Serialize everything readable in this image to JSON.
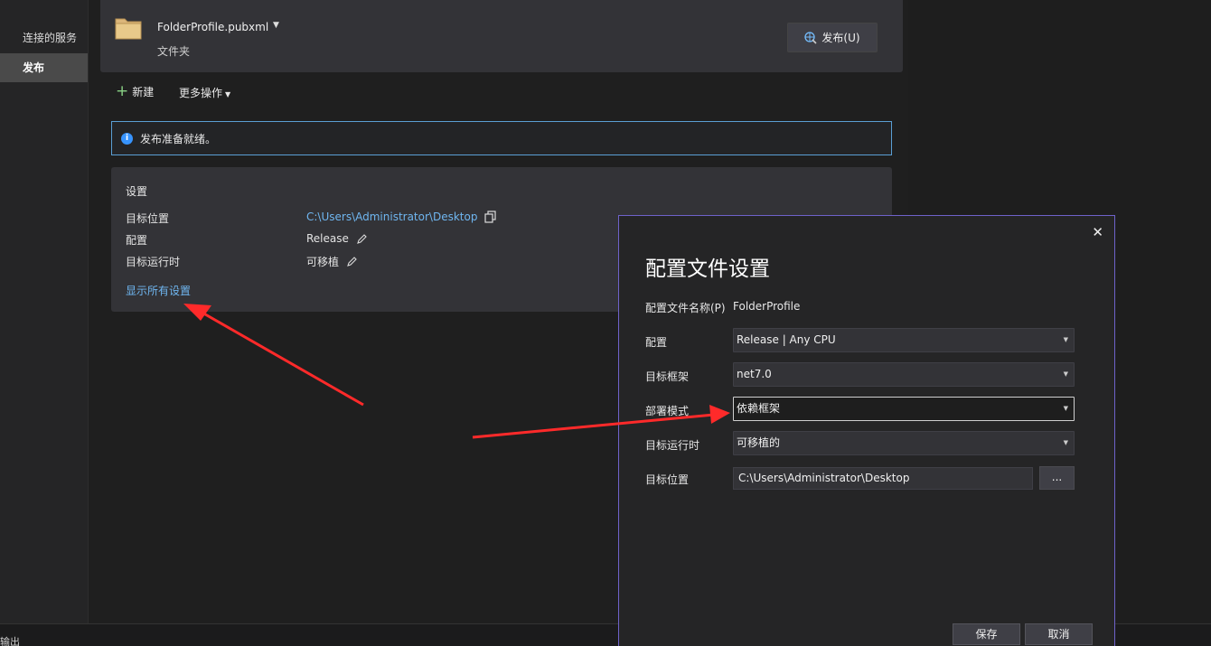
{
  "sidebar": {
    "items": [
      {
        "label": "连接的服务"
      },
      {
        "label": "发布"
      }
    ]
  },
  "profile": {
    "name": "FolderProfile.pubxml",
    "type": "文件夹",
    "publish_label": "发布(U)"
  },
  "toolbar": {
    "new_label": "新建",
    "more_label": "更多操作"
  },
  "info": {
    "message": "发布准备就绪。"
  },
  "settings": {
    "title": "设置",
    "rows": [
      {
        "label": "目标位置",
        "value": "C:\\Users\\Administrator\\Desktop"
      },
      {
        "label": "配置",
        "value": "Release"
      },
      {
        "label": "目标运行时",
        "value": "可移植"
      }
    ],
    "show_all": "显示所有设置"
  },
  "dialog": {
    "title": "配置文件设置",
    "profile_name_label": "配置文件名称(P)",
    "profile_name_value": "FolderProfile",
    "configuration_label": "配置",
    "configuration_value": "Release | Any CPU",
    "framework_label": "目标框架",
    "framework_value": "net7.0",
    "deploy_mode_label": "部署模式",
    "deploy_mode_value": "依赖框架",
    "runtime_label": "目标运行时",
    "runtime_value": "可移植的",
    "location_label": "目标位置",
    "location_value": "C:\\Users\\Administrator\\Desktop",
    "browse_label": "...",
    "save_label": "保存",
    "cancel_label": "取消",
    "close_glyph": "✕"
  },
  "statusbar": {
    "text": "输出"
  },
  "colors": {
    "accent_link": "#6fb6f0",
    "info_border": "#5a9fd4",
    "dialog_border": "#6e62c9",
    "annotation_arrow": "#ff2a2a"
  }
}
